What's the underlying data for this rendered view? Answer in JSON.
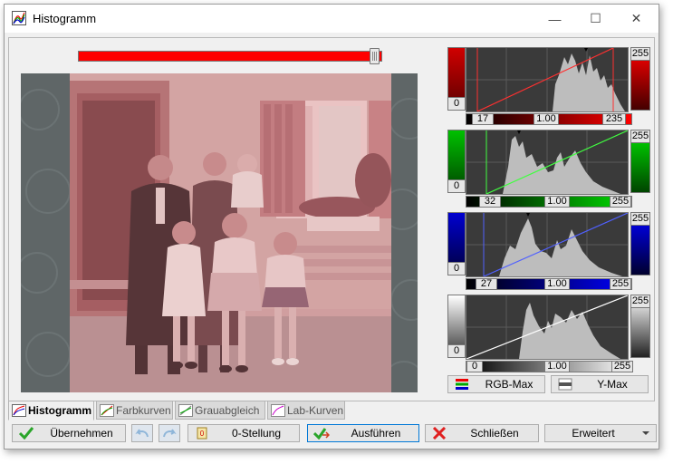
{
  "window": {
    "title": "Histogramm",
    "minimize_label": "—",
    "maximize_label": "☐",
    "close_label": "✕"
  },
  "slider": {
    "level": 0.99
  },
  "histograms": {
    "red": {
      "low_value": "0",
      "high_value": "255",
      "input_low": "17",
      "gamma": "1.00",
      "input_high": "235",
      "color": "#ff0000"
    },
    "green": {
      "low_value": "0",
      "high_value": "255",
      "input_low": "32",
      "gamma": "1.00",
      "input_high": "255",
      "color": "#00cc00"
    },
    "blue": {
      "low_value": "0",
      "high_value": "255",
      "input_low": "27",
      "gamma": "1.00",
      "input_high": "255",
      "color": "#0000cc"
    },
    "gray": {
      "low_value": "0",
      "high_value": "255",
      "input_low": "0",
      "gamma": "1.00",
      "input_high": "255",
      "color": "#ffffff"
    }
  },
  "hist_buttons": {
    "rgb_max": "RGB-Max",
    "y_max": "Y-Max"
  },
  "tabs": [
    {
      "label": "Histogramm"
    },
    {
      "label": "Farbkurven"
    },
    {
      "label": "Grauabgleich"
    },
    {
      "label": "Lab-Kurven"
    }
  ],
  "bottom": {
    "apply": "Übernehmen",
    "zero": "0-Stellung",
    "execute": "Ausführen",
    "close": "Schließen",
    "extended": "Erweitert"
  },
  "colors": {
    "accent_red": "#ff0000",
    "titlebar": "#ffffff",
    "dialog_bg": "#f0f0f0",
    "photo_tint": "#c98a8c",
    "focus_border": "#0078d7"
  }
}
